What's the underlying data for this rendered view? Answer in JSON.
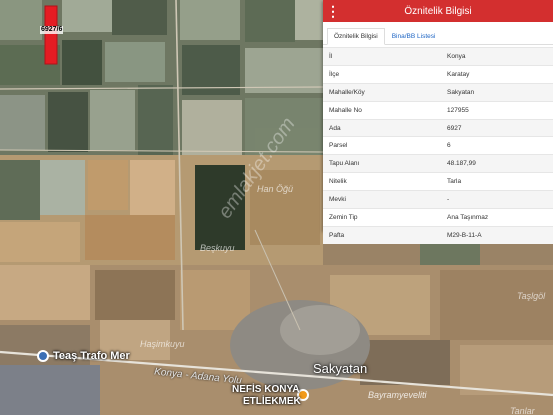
{
  "panel": {
    "title": "Öznitelik Bilgisi",
    "menu_icon": "⋮",
    "tabs": [
      {
        "label": "Öznitelik Bilgisi",
        "active": true
      },
      {
        "label": "Bina/BB Listesi",
        "active": false
      }
    ],
    "rows": [
      {
        "key": "İl",
        "value": "Konya"
      },
      {
        "key": "İlçe",
        "value": "Karatay"
      },
      {
        "key": "Mahalle/Köy",
        "value": "Sakyatan"
      },
      {
        "key": "Mahalle No",
        "value": "127955"
      },
      {
        "key": "Ada",
        "value": "6927"
      },
      {
        "key": "Parsel",
        "value": "6"
      },
      {
        "key": "Tapu Alanı",
        "value": "48.187,99"
      },
      {
        "key": "Nitelik",
        "value": "Tarla"
      },
      {
        "key": "Mevki",
        "value": "-"
      },
      {
        "key": "Zemin Tip",
        "value": "Ana Taşınmaz"
      },
      {
        "key": "Pafta",
        "value": "M29-B-11-A"
      }
    ]
  },
  "map": {
    "parcel_label": "6927/6",
    "places": {
      "han_ogu": "Han Öğü",
      "beskuyu": "Beşkuyu",
      "hasimkuyu": "Haşimkuyu",
      "sakyatan": "Sakyatan",
      "taslgol": "Taşlgöl",
      "bayramyeveliti": "Bayramyeveliti",
      "tanlar": "Tanlar"
    },
    "road": "Konya - Adana Yolu",
    "pois": {
      "teias": "Teaş Trafo Mer",
      "nefis_line1": "NEFİS KONYA",
      "nefis_line2": "ETLİEKMEK"
    },
    "watermark": "emlakjet.com"
  },
  "colors": {
    "header": "#d32f2f",
    "tab_link": "#1f66c4",
    "parcel": "#e51c23"
  }
}
